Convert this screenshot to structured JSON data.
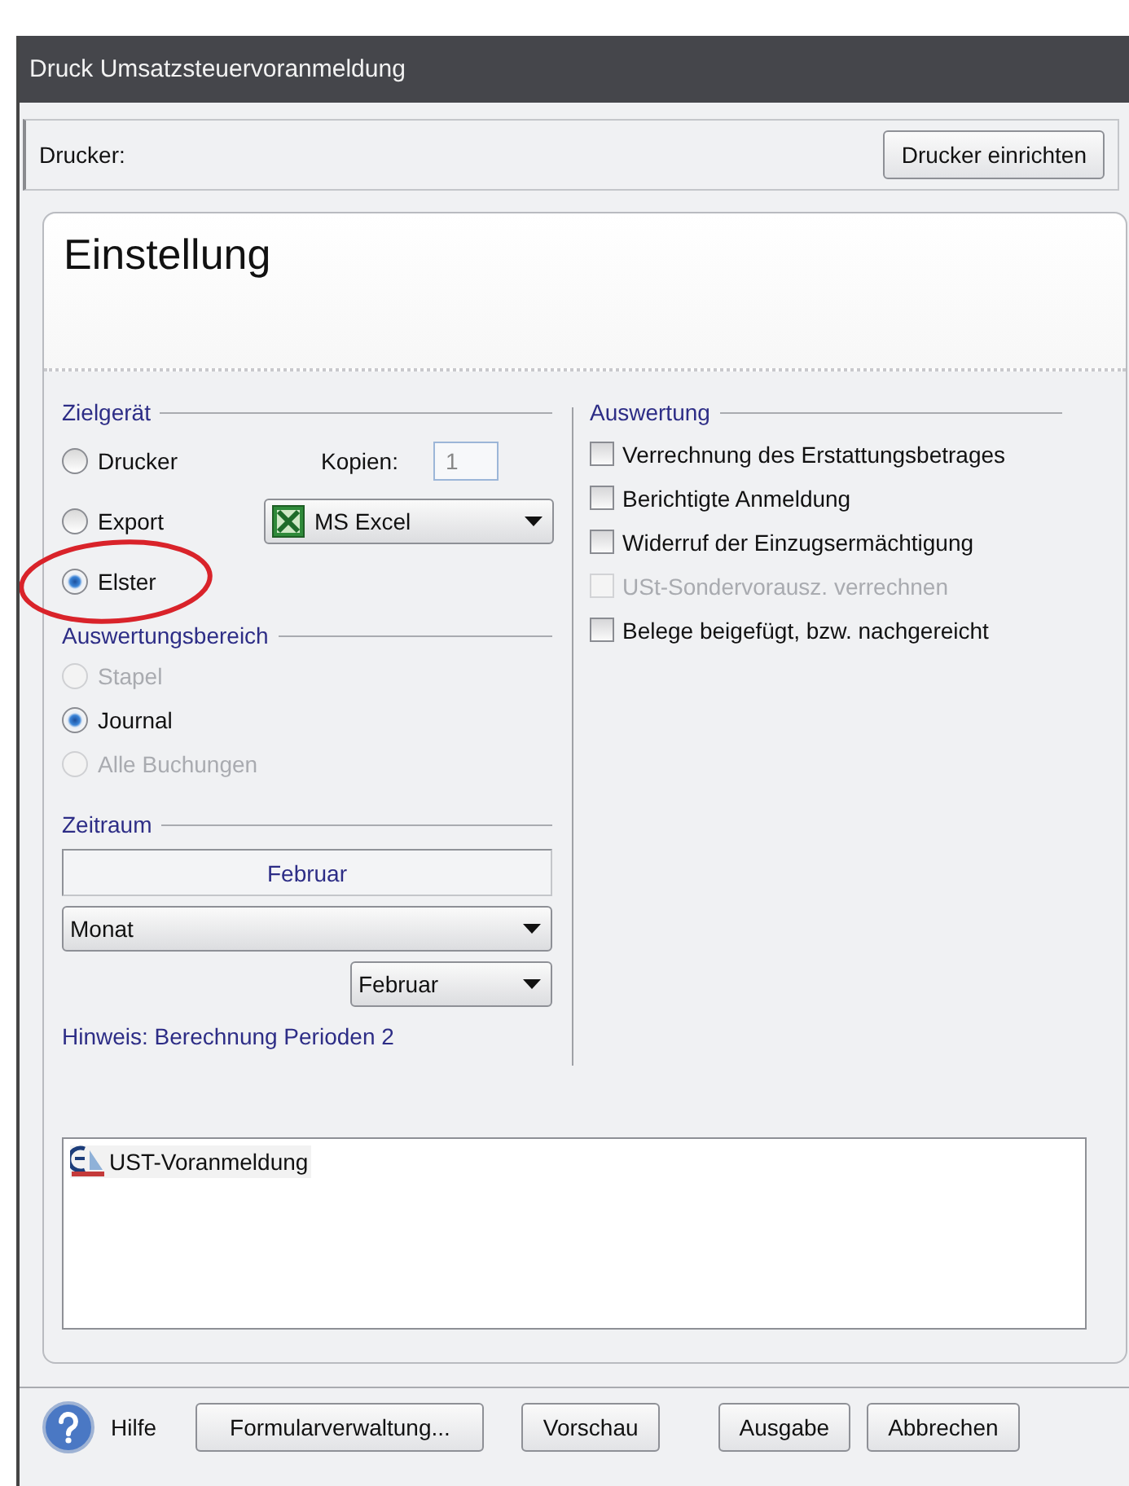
{
  "window": {
    "title": "Druck Umsatzsteuervoranmeldung"
  },
  "printer": {
    "label": "Drucker:",
    "button": "Drucker einrichten"
  },
  "panel": {
    "title": "Einstellung"
  },
  "zielgeraet": {
    "legend": "Zielgerät",
    "copies_label": "Kopien:",
    "copies": "1",
    "export_format": "MS Excel",
    "options": [
      {
        "label": "Drucker",
        "selected": false,
        "disabled": false
      },
      {
        "label": "Export",
        "selected": false,
        "disabled": false
      },
      {
        "label": "Elster",
        "selected": true,
        "disabled": false,
        "circled": true
      }
    ]
  },
  "auswertungsbereich": {
    "legend": "Auswertungsbereich",
    "options": [
      {
        "label": "Stapel",
        "selected": false,
        "disabled": true
      },
      {
        "label": "Journal",
        "selected": true,
        "disabled": false
      },
      {
        "label": "Alle Buchungen",
        "selected": false,
        "disabled": true
      }
    ]
  },
  "zeitraum": {
    "legend": "Zeitraum",
    "display": "Februar",
    "period_type": "Monat",
    "period": "Februar"
  },
  "hint": "Hinweis: Berechnung Perioden 2",
  "auswertung": {
    "legend": "Auswertung",
    "options": [
      {
        "label": "Verrechnung des Erstattungsbetrages",
        "checked": false,
        "disabled": false
      },
      {
        "label": "Berichtigte Anmeldung",
        "checked": false,
        "disabled": false
      },
      {
        "label": "Widerruf der Einzugsermächtigung",
        "checked": false,
        "disabled": false
      },
      {
        "label": "USt-Sondervorausz. verrechnen",
        "checked": false,
        "disabled": true
      },
      {
        "label": "Belege beigefügt, bzw. nachgereicht",
        "checked": false,
        "disabled": false
      }
    ]
  },
  "forms": [
    {
      "label": "UST-Voranmeldung"
    }
  ],
  "footer": {
    "help": "Hilfe",
    "buttons": [
      "Formularverwaltung...",
      "Vorschau",
      "Ausgabe",
      "Abbrechen"
    ]
  }
}
